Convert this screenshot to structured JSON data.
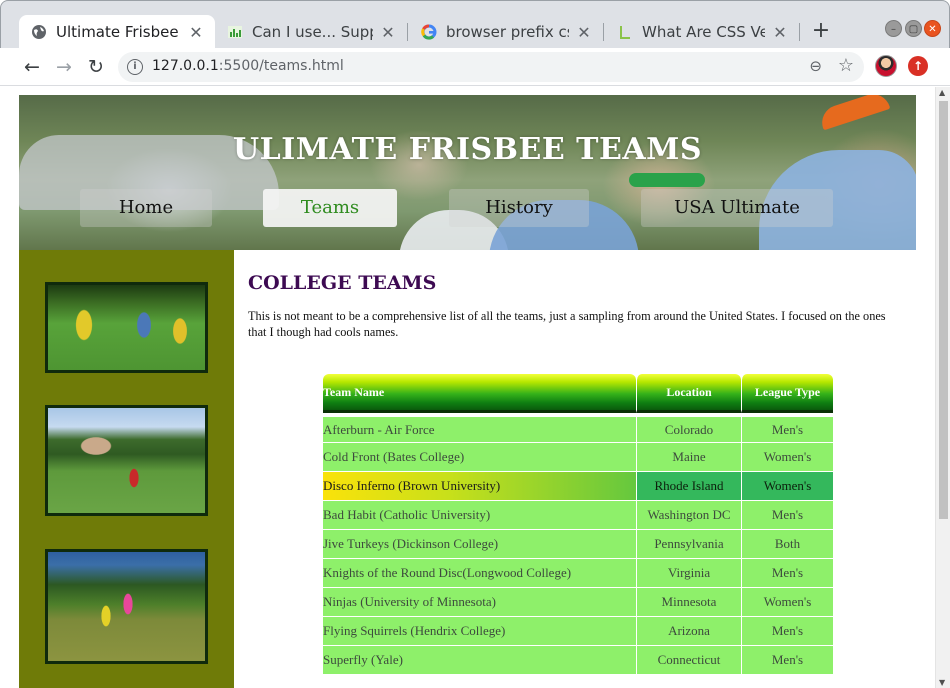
{
  "browser": {
    "tabs": [
      {
        "title": "Ultimate Frisbee - T",
        "icon": "globe-icon",
        "active": true
      },
      {
        "title": "Can I use... Support",
        "icon": "caniuse-icon",
        "active": false
      },
      {
        "title": "browser prefix css",
        "icon": "google-icon",
        "active": false
      },
      {
        "title": "What Are CSS Vend",
        "icon": "document-icon",
        "active": false
      }
    ],
    "close_glyph": "✕",
    "new_tab_glyph": "+",
    "url_host": "127.0.0.1",
    "url_rest": ":5500/teams.html",
    "back_glyph": "←",
    "forward_glyph": "→",
    "reload_glyph": "↻",
    "zoom_glyph": "⊖",
    "star_glyph": "☆",
    "info_glyph": "i",
    "update_glyph": "↑",
    "min_glyph": "–",
    "max_glyph": "▢",
    "window_close_glyph": "✕"
  },
  "site": {
    "title": "ULIMATE FRISBEE TEAMS",
    "nav": [
      {
        "label": "Home",
        "active": false
      },
      {
        "label": "Teams",
        "active": true
      },
      {
        "label": "History",
        "active": false
      },
      {
        "label": "USA Ultimate",
        "active": false
      }
    ],
    "heading": "COLLEGE TEAMS",
    "intro": "This is not meant to be a comprehensive list of all the teams, just a sampling from around the United States. I focused on the ones that I though had cools names.",
    "table": {
      "headers": [
        "Team Name",
        "Location",
        "League Type"
      ],
      "rows": [
        [
          "Afterburn - Air Force",
          "Colorado",
          "Men's"
        ],
        [
          "Cold Front (Bates College)",
          "Maine",
          "Women's"
        ],
        [
          "Disco Inferno (Brown University)",
          "Rhode Island",
          "Women's"
        ],
        [
          "Bad Habit (Catholic University)",
          "Washington DC",
          "Men's"
        ],
        [
          "Jive Turkeys (Dickinson College)",
          "Pennsylvania",
          "Both"
        ],
        [
          "Knights of the Round Disc(Longwood College)",
          "Virginia",
          "Men's"
        ],
        [
          "Ninjas (University of Minnesota)",
          "Minnesota",
          "Women's"
        ],
        [
          "Flying Squirrels (Hendrix College)",
          "Arizona",
          "Men's"
        ],
        [
          "Superfly (Yale)",
          "Connecticut",
          "Men's"
        ]
      ],
      "highlighted_row": 2
    }
  },
  "colors": {
    "sidebar": "#6f7b08",
    "heading": "#3d0a52",
    "row": "#8ef06a",
    "active_nav_text": "#2e8b1e"
  }
}
